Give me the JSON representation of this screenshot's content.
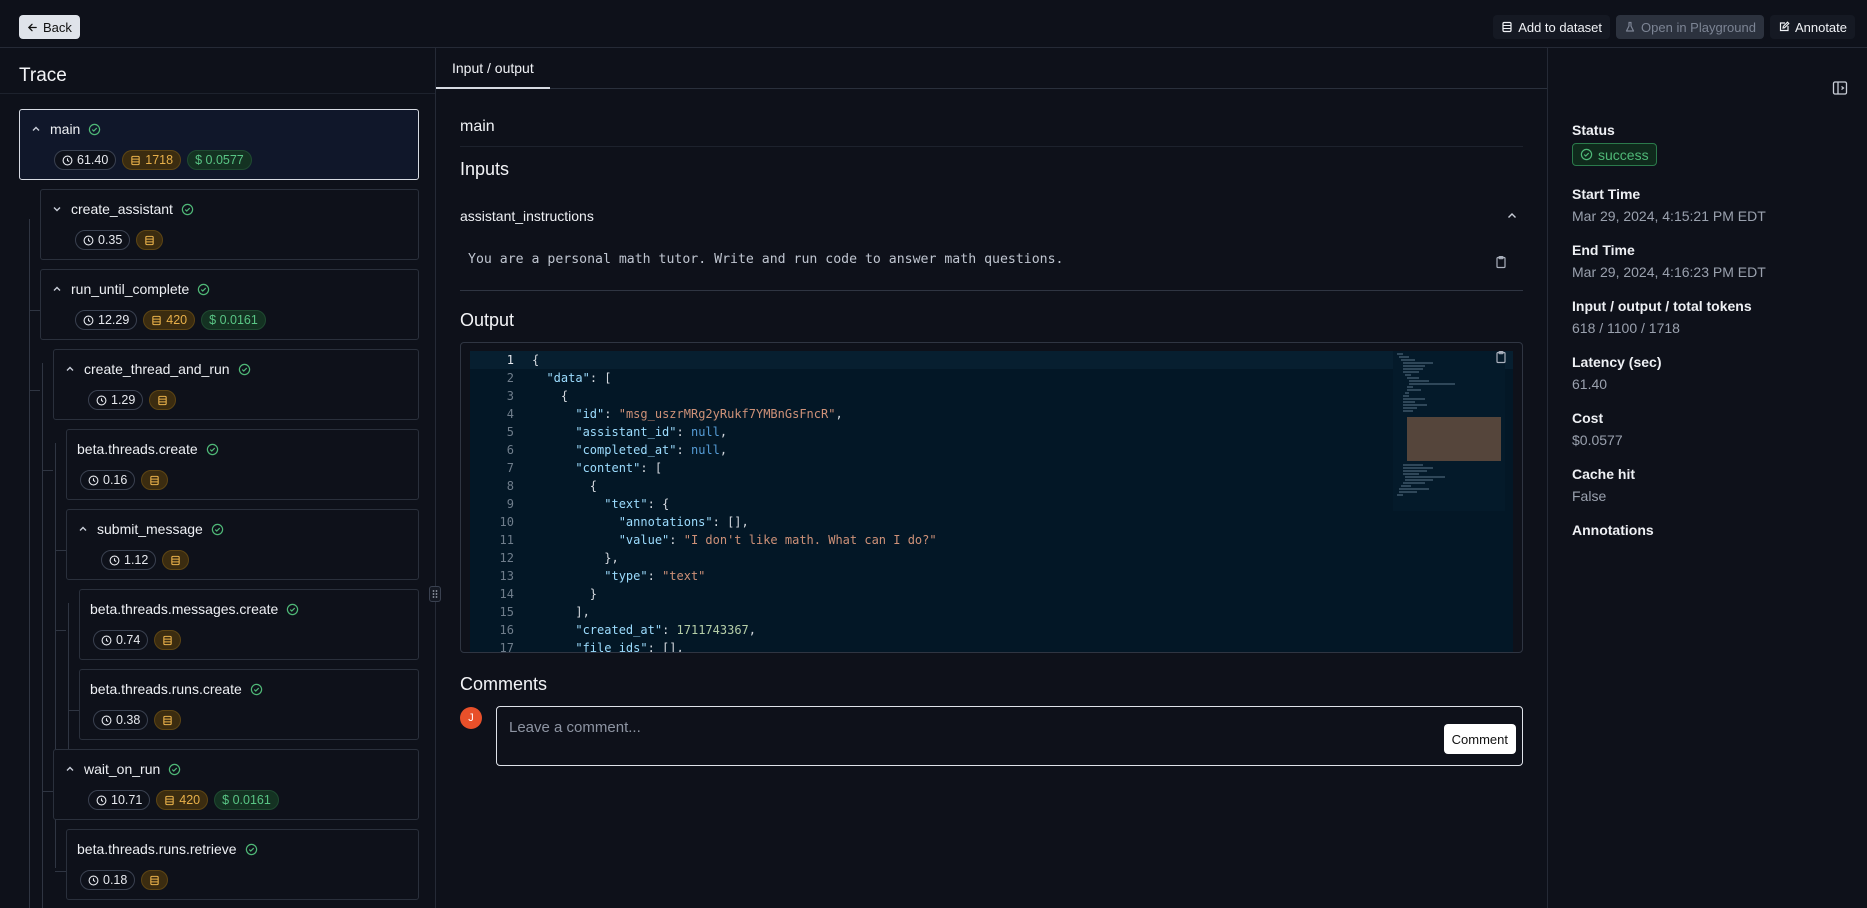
{
  "topbar": {
    "back_label": "Back",
    "add_to_dataset_label": "Add to dataset",
    "open_in_playground_label": "Open in Playground",
    "annotate_label": "Annotate"
  },
  "trace": {
    "title": "Trace",
    "nodes": [
      {
        "name": "main",
        "time": "61.40",
        "tokens": "1718",
        "cost": "$ 0.0577",
        "expanded": true
      },
      {
        "name": "create_assistant",
        "time": "0.35",
        "tokens": "",
        "cost": "",
        "expanded": false
      },
      {
        "name": "run_until_complete",
        "time": "12.29",
        "tokens": "420",
        "cost": "$ 0.0161",
        "expanded": true
      },
      {
        "name": "create_thread_and_run",
        "time": "1.29",
        "tokens": "",
        "cost": "",
        "expanded": true
      },
      {
        "name": "beta.threads.create",
        "time": "0.16",
        "tokens": "",
        "cost": ""
      },
      {
        "name": "submit_message",
        "time": "1.12",
        "tokens": "",
        "cost": "",
        "expanded": true
      },
      {
        "name": "beta.threads.messages.create",
        "time": "0.74",
        "tokens": "",
        "cost": ""
      },
      {
        "name": "beta.threads.runs.create",
        "time": "0.38",
        "tokens": "",
        "cost": ""
      },
      {
        "name": "wait_on_run",
        "time": "10.71",
        "tokens": "420",
        "cost": "$ 0.0161",
        "expanded": true
      },
      {
        "name": "beta.threads.runs.retrieve",
        "time": "0.18",
        "tokens": "",
        "cost": ""
      }
    ]
  },
  "main": {
    "tab_label": "Input / output",
    "run_name": "main",
    "inputs_title": "Inputs",
    "input_field_name": "assistant_instructions",
    "input_field_value": "You are a personal math tutor. Write and run code to answer math questions.",
    "output_title": "Output",
    "output_lines": [
      "{",
      "  \"data\": [",
      "    {",
      "      \"id\": \"msg_uszrMRg2yRukf7YMBnGsFncR\",",
      "      \"assistant_id\": null,",
      "      \"completed_at\": null,",
      "      \"content\": [",
      "        {",
      "          \"text\": {",
      "            \"annotations\": [],",
      "            \"value\": \"I don't like math. What can I do?\"",
      "          },",
      "          \"type\": \"text\"",
      "        }",
      "      ],",
      "      \"created_at\": 1711743367,",
      "      \"file_ids\": [],"
    ],
    "comments_title": "Comments",
    "avatar_initial": "J",
    "comment_placeholder": "Leave a comment...",
    "comment_button_label": "Comment"
  },
  "details": {
    "status_label": "Status",
    "status_value": "success",
    "start_time_label": "Start Time",
    "start_time_value": "Mar 29, 2024, 4:15:21 PM EDT",
    "end_time_label": "End Time",
    "end_time_value": "Mar 29, 2024, 4:16:23 PM EDT",
    "tokens_label": "Input / output / total tokens",
    "tokens_value": "618 / 1100 / 1718",
    "latency_label": "Latency (sec)",
    "latency_value": "61.40",
    "cost_label": "Cost",
    "cost_value": "$0.0577",
    "cache_label": "Cache hit",
    "cache_value": "False",
    "annotations_label": "Annotations"
  },
  "colors": {
    "background": "#0e111a",
    "success_green": "#4fb877",
    "token_amber": "#e8b04a",
    "avatar": "#e8502a"
  }
}
